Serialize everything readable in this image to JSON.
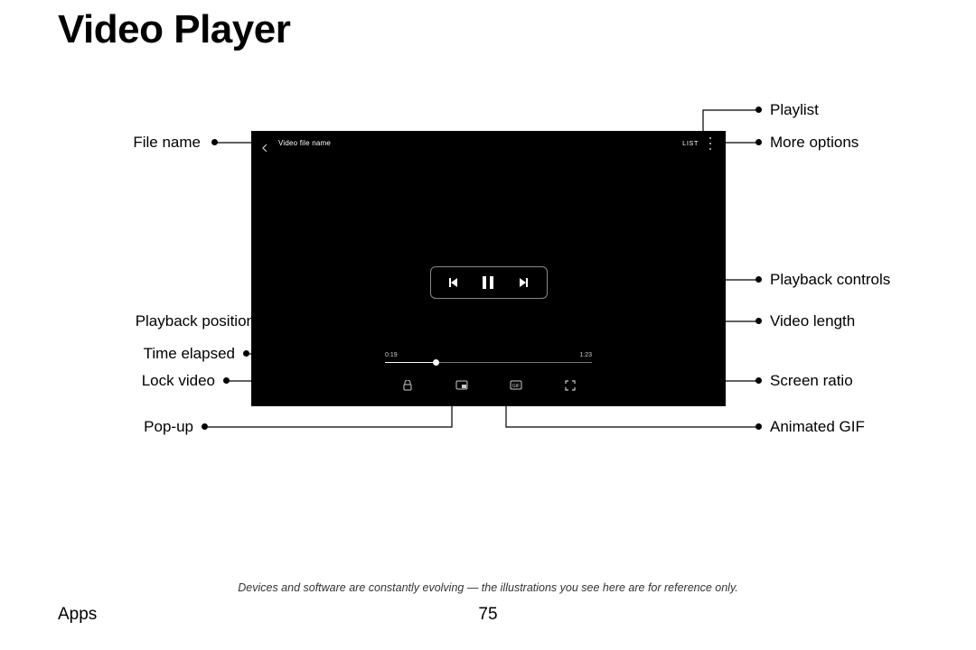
{
  "title": "Video Player",
  "player": {
    "file_name": "Video file name",
    "list_label": "LIST",
    "time_elapsed": "0:19",
    "time_total": "1:23"
  },
  "callouts": {
    "file_name": "File name",
    "playlist": "Playlist",
    "more_options": "More options",
    "playback_controls": "Playback controls",
    "playback_position": "Playback position",
    "video_length": "Video length",
    "time_elapsed": "Time elapsed",
    "lock_video": "Lock video",
    "screen_ratio": "Screen ratio",
    "popup": "Pop-up",
    "animated_gif": "Animated GIF"
  },
  "disclaimer": "Devices and software are constantly evolving — the illustrations you see here are for reference only.",
  "footer": {
    "section": "Apps",
    "page": "75"
  }
}
